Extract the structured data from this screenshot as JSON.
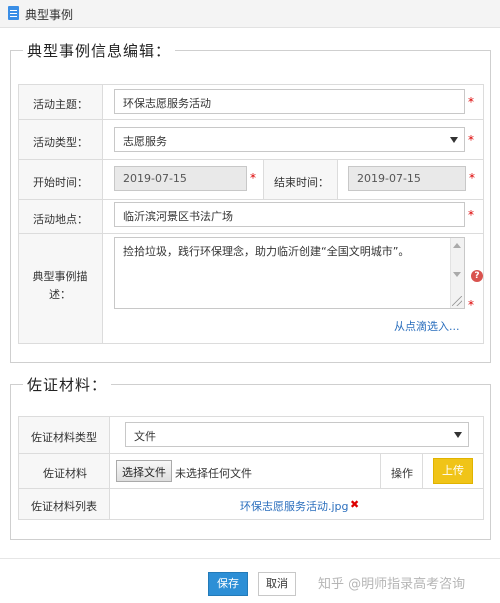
{
  "window": {
    "title": "典型事例"
  },
  "section_info": {
    "title": "典型事例信息编辑：",
    "fields": {
      "theme": {
        "label": "活动主题：",
        "value": "环保志愿服务活动"
      },
      "type": {
        "label": "活动类型：",
        "value": "志愿服务"
      },
      "start": {
        "label": "开始时间：",
        "value": "2019-07-15"
      },
      "end": {
        "label": "结束时间：",
        "value": "2019-07-15"
      },
      "location": {
        "label": "活动地点：",
        "value": "临沂滨河景区书法广场"
      },
      "desc": {
        "label": "典型事例描述：",
        "value": "捡拾垃圾，践行环保理念，助力临沂创建“全国文明城市”。"
      }
    },
    "pick_link": "从点滴选入...",
    "required_mark": "*",
    "help_icon": "?"
  },
  "section_evidence": {
    "title": "佐证材料：",
    "type_label": "佐证材料类型",
    "type_value": "文件",
    "material_label": "佐证材料",
    "choose_file": "选择文件",
    "no_file": "未选择任何文件",
    "op_label": "操作",
    "upload": "上传",
    "list_label": "佐证材料列表",
    "file_name": "环保志愿服务活动.jpg",
    "remove_mark": "✖"
  },
  "footer": {
    "save": "保存",
    "cancel": "取消",
    "watermark": "知乎 @明师指录高考咨询"
  },
  "colors": {
    "primary": "#2d8fd6",
    "upload": "#f0c418",
    "required": "#dd0000",
    "link": "#2a6ebd"
  }
}
